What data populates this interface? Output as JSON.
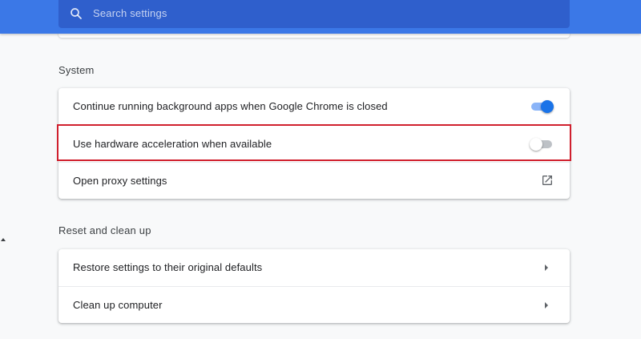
{
  "search": {
    "placeholder": "Search settings",
    "icon": "search-icon"
  },
  "sections": {
    "system": {
      "title": "System",
      "rows": [
        {
          "label": "Continue running background apps when Google Chrome is closed",
          "control": "toggle",
          "state": "on"
        },
        {
          "label": "Use hardware acceleration when available",
          "control": "toggle",
          "state": "off",
          "highlighted": true
        },
        {
          "label": "Open proxy settings",
          "control": "launch-icon"
        }
      ]
    },
    "reset": {
      "title": "Reset and clean up",
      "rows": [
        {
          "label": "Restore settings to their original defaults",
          "control": "arrow-right-icon"
        },
        {
          "label": "Clean up computer",
          "control": "arrow-right-icon"
        }
      ]
    }
  },
  "colors": {
    "header": "#3b78e7",
    "search_box": "#2f5fcc",
    "toggle_on": "#1a73e8",
    "highlight": "#d0202e"
  }
}
